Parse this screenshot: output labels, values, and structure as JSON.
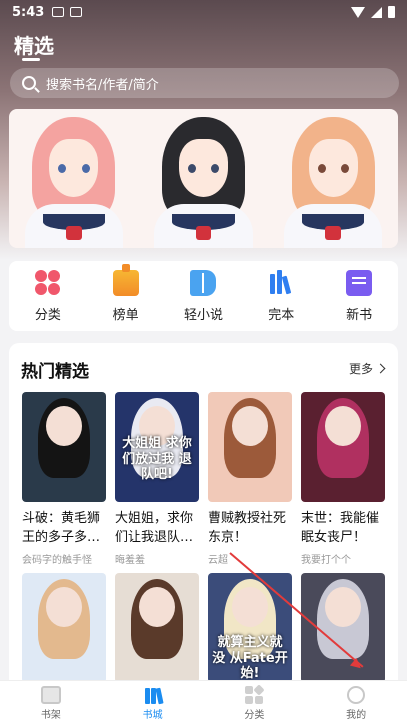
{
  "status_bar": {
    "time": "5:43"
  },
  "header": {
    "title": "精选"
  },
  "search": {
    "placeholder": "搜索书名/作者/简介"
  },
  "categories": [
    {
      "label": "分类",
      "icon": "clover-icon",
      "color": "#f0576b"
    },
    {
      "label": "榜单",
      "icon": "ranking-icon",
      "color": "#f28c28"
    },
    {
      "label": "轻小说",
      "icon": "book-open-icon",
      "color": "#4aa3f0"
    },
    {
      "label": "完本",
      "icon": "finished-books-icon",
      "color": "#2f7ef0"
    },
    {
      "label": "新书",
      "icon": "new-book-icon",
      "color": "#7a5cf0"
    }
  ],
  "hot_section": {
    "title": "热门精选",
    "more_label": "更多",
    "books": [
      {
        "title": "斗破：黄毛狮王的多子多…",
        "author": "会码字的触手怪",
        "cover_color": "#2a3a4a",
        "hair_color": "#141414",
        "cover_text": ""
      },
      {
        "title": "大姐姐，求你们让我退队…",
        "author": "晦羞羞",
        "cover_color": "#24346a",
        "hair_color": "#e9eaf2",
        "cover_text": "大姐姐 求你们放过我 退队吧!"
      },
      {
        "title": "曹贼教授社死东京！",
        "author": "云超",
        "cover_color": "#f1c9b8",
        "hair_color": "#9c5a3a",
        "cover_text": ""
      },
      {
        "title": "末世：我能催眠女丧尸！",
        "author": "我要打个个",
        "cover_color": "#5a2030",
        "hair_color": "#b03060",
        "cover_text": ""
      },
      {
        "title": "",
        "author": "",
        "cover_color": "#dfe9f5",
        "hair_color": "#e3b98e",
        "cover_text": ""
      },
      {
        "title": "",
        "author": "",
        "cover_color": "#e6ddd4",
        "hair_color": "#5a3a2a",
        "cover_text": ""
      },
      {
        "title": "",
        "author": "",
        "cover_color": "#3b4c7a",
        "hair_color": "#f1e6c6",
        "cover_text": "就算主义就没 从Fate开始!"
      },
      {
        "title": "",
        "author": "",
        "cover_color": "#4a4a5a",
        "hair_color": "#c8c8d4",
        "cover_text": ""
      }
    ]
  },
  "bottom_nav": {
    "items": [
      {
        "label": "书架",
        "icon": "bookshelf-icon"
      },
      {
        "label": "书城",
        "icon": "bookstore-icon",
        "active": true
      },
      {
        "label": "分类",
        "icon": "category-grid-icon"
      },
      {
        "label": "我的",
        "icon": "profile-icon"
      }
    ]
  },
  "colors": {
    "accent": "#1b8cf0",
    "annotation": "#e23b3b"
  }
}
